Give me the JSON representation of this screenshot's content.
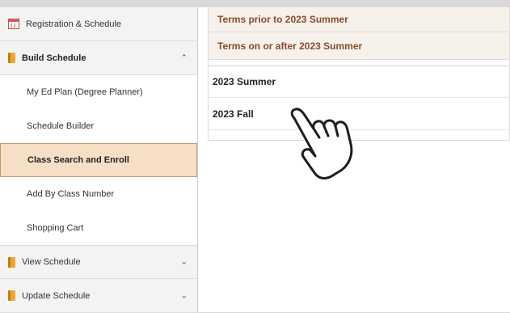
{
  "sidebar": {
    "sections": [
      {
        "label": "Registration & Schedule",
        "icon": "calendar-icon"
      },
      {
        "label": "Build Schedule",
        "icon": "book-icon",
        "chevron": "chevron-up-icon"
      },
      {
        "label": "View Schedule",
        "icon": "book-icon",
        "chevron": "chevron-down-icon"
      },
      {
        "label": "Update Schedule",
        "icon": "book-icon",
        "chevron": "chevron-down-icon"
      }
    ],
    "sub_items": [
      {
        "label": "My Ed Plan (Degree Planner)"
      },
      {
        "label": "Schedule Builder"
      },
      {
        "label": "Class Search and Enroll",
        "active": true
      },
      {
        "label": "Add By Class Number"
      },
      {
        "label": "Shopping Cart"
      }
    ],
    "collapse_handle_glyph": "II",
    "chevron_up": "⌃",
    "chevron_down": "⌄"
  },
  "terms": {
    "groups": [
      {
        "label": "Terms prior to 2023 Summer"
      },
      {
        "label": "Terms on or after 2023 Summer"
      }
    ],
    "rows": [
      {
        "label": "2023 Summer"
      },
      {
        "label": "2023 Fall"
      }
    ]
  },
  "colors": {
    "accent_text": "#8a4a2a",
    "active_bg": "#f6dfc4",
    "active_border": "#c89a62"
  }
}
